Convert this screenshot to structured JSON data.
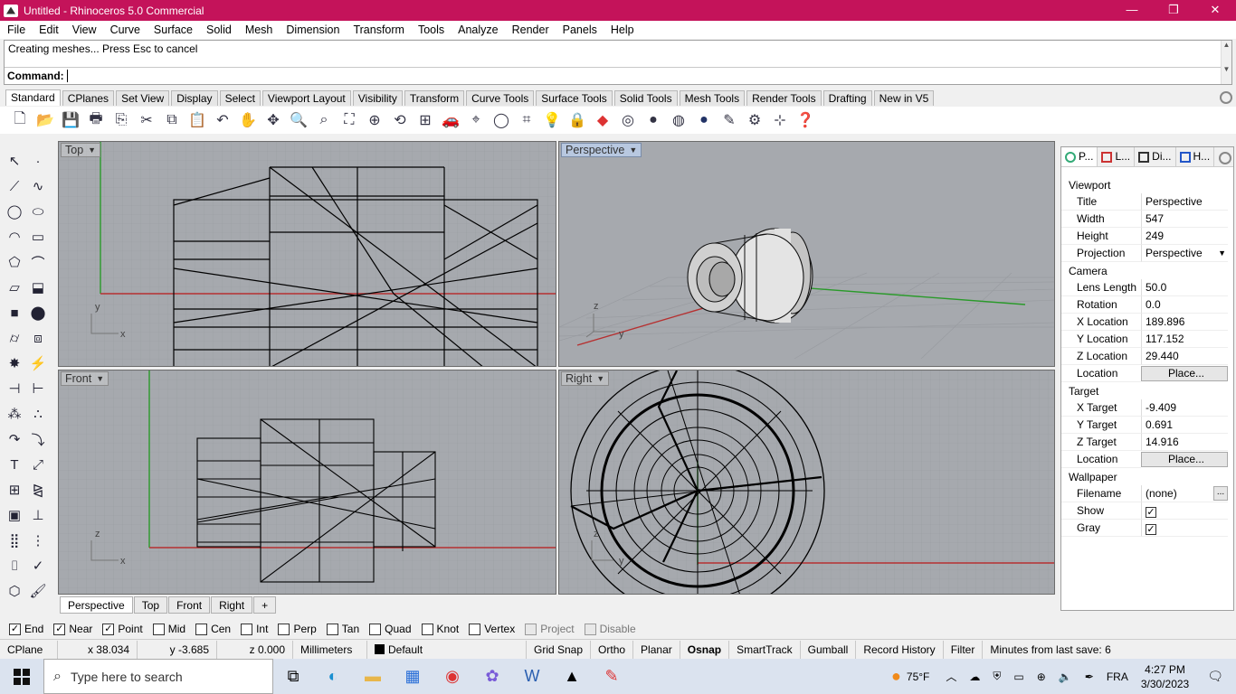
{
  "window": {
    "title": "Untitled - Rhinoceros 5.0 Commercial",
    "accent": "#c4135a",
    "minimize": "—",
    "restore": "❐",
    "close": "✕"
  },
  "menu": [
    "File",
    "Edit",
    "View",
    "Curve",
    "Surface",
    "Solid",
    "Mesh",
    "Dimension",
    "Transform",
    "Tools",
    "Analyze",
    "Render",
    "Panels",
    "Help"
  ],
  "command": {
    "history": "Creating meshes... Press Esc to cancel",
    "prompt": "Command:",
    "value": ""
  },
  "toolbar_tabs": [
    "Standard",
    "CPlanes",
    "Set View",
    "Display",
    "Select",
    "Viewport Layout",
    "Visibility",
    "Transform",
    "Curve Tools",
    "Surface Tools",
    "Solid Tools",
    "Mesh Tools",
    "Render Tools",
    "Drafting",
    "New in V5"
  ],
  "toolbar_icons": [
    "new-icon",
    "open-icon",
    "save-icon",
    "print-icon",
    "import-icon",
    "cut-icon",
    "copy-icon",
    "paste-icon",
    "undo-icon",
    "pan-icon",
    "move-icon",
    "zoom-icon",
    "zoom-window-icon",
    "zoom-extents-icon",
    "zoom-selected-icon",
    "rotate-view-icon",
    "four-viewports-icon",
    "car-icon",
    "ghosted-icon",
    "circle-icon",
    "cplane-icon",
    "light-icon",
    "lock-icon",
    "layer-icon",
    "color-wheel-icon",
    "material-icon",
    "sphere-render-icon",
    "render-icon",
    "options-icon",
    "settings-icon",
    "grid-icon",
    "help-icon"
  ],
  "viewports": {
    "top": {
      "label": "Top",
      "axis_a": "y",
      "axis_b": "x"
    },
    "perspective": {
      "label": "Perspective",
      "axis_a": "z",
      "axis_b": "y"
    },
    "front": {
      "label": "Front",
      "axis_a": "z",
      "axis_b": "x"
    },
    "right": {
      "label": "Right",
      "axis_a": "z",
      "axis_b": "y"
    }
  },
  "viewport_tabs": [
    "Perspective",
    "Top",
    "Front",
    "Right",
    "+"
  ],
  "panel": {
    "tabs": [
      "P...",
      "L...",
      "Di...",
      "H..."
    ],
    "sections": {
      "viewport": "Viewport",
      "camera": "Camera",
      "target": "Target",
      "wallpaper": "Wallpaper"
    },
    "viewport_rows": [
      [
        "Title",
        "Perspective"
      ],
      [
        "Width",
        "547"
      ],
      [
        "Height",
        "249"
      ],
      [
        "Projection",
        "Perspective"
      ]
    ],
    "camera_rows": [
      [
        "Lens Length",
        "50.0"
      ],
      [
        "Rotation",
        "0.0"
      ],
      [
        "X Location",
        "189.896"
      ],
      [
        "Y Location",
        "117.152"
      ],
      [
        "Z Location",
        "29.440"
      ],
      [
        "Location",
        "Place..."
      ]
    ],
    "target_rows": [
      [
        "X Target",
        "-9.409"
      ],
      [
        "Y Target",
        "0.691"
      ],
      [
        "Z Target",
        "14.916"
      ],
      [
        "Location",
        "Place..."
      ]
    ],
    "wallpaper_rows": [
      [
        "Filename",
        "(none)"
      ],
      [
        "Show",
        "✓"
      ],
      [
        "Gray",
        "✓"
      ]
    ]
  },
  "osnap": [
    {
      "label": "End",
      "checked": true
    },
    {
      "label": "Near",
      "checked": true
    },
    {
      "label": "Point",
      "checked": true
    },
    {
      "label": "Mid",
      "checked": false
    },
    {
      "label": "Cen",
      "checked": false
    },
    {
      "label": "Int",
      "checked": false
    },
    {
      "label": "Perp",
      "checked": false
    },
    {
      "label": "Tan",
      "checked": false
    },
    {
      "label": "Quad",
      "checked": false
    },
    {
      "label": "Knot",
      "checked": false
    },
    {
      "label": "Vertex",
      "checked": false
    },
    {
      "label": "Project",
      "checked": false
    },
    {
      "label": "Disable",
      "checked": false
    }
  ],
  "status": {
    "cplane": "CPlane",
    "x": "x 38.034",
    "y": "y -3.685",
    "z": "z 0.000",
    "units": "Millimeters",
    "layer": "Default",
    "toggles": [
      "Grid Snap",
      "Ortho",
      "Planar",
      "Osnap",
      "SmartTrack",
      "Gumball",
      "Record History",
      "Filter"
    ],
    "active_toggle": "Osnap",
    "autosave": "Minutes from last save: 6"
  },
  "taskbar": {
    "search_placeholder": "Type here to search",
    "weather": "75°F",
    "lang": "FRA",
    "time": "4:27 PM",
    "date": "3/30/2023"
  }
}
